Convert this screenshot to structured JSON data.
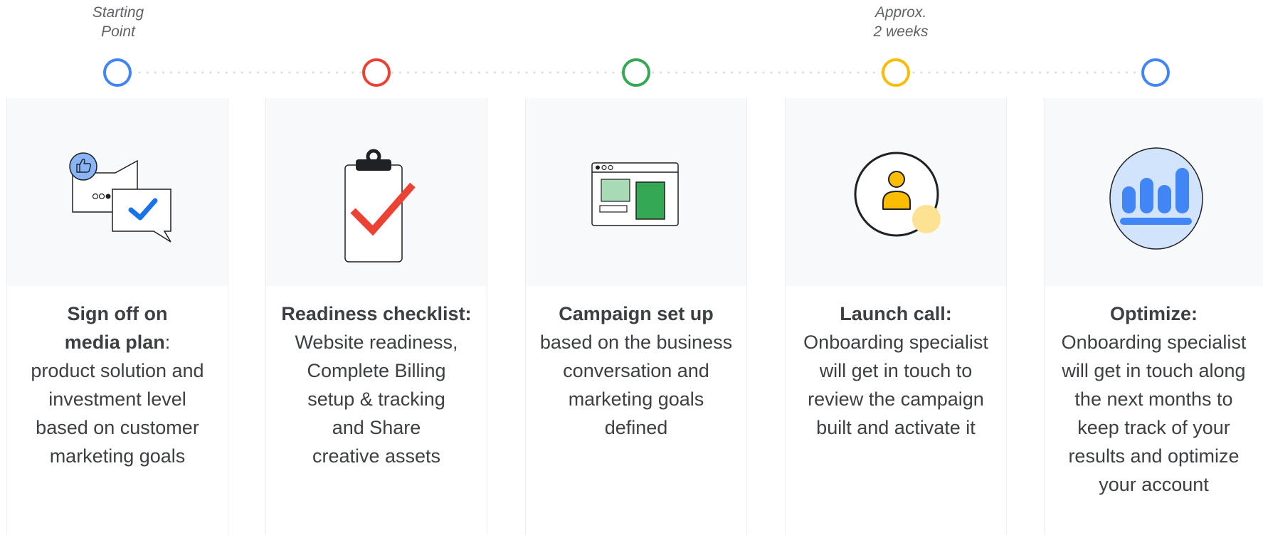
{
  "markers": {
    "start": [
      "Starting",
      "Point"
    ],
    "approx": [
      "Approx.",
      "2 weeks"
    ]
  },
  "colors": {
    "blue": "#4285f4",
    "red": "#ea4335",
    "green": "#34a853",
    "yellow": "#fbbc04",
    "dots": "#dadce0"
  },
  "steps": [
    {
      "id": "sign-off",
      "color": "blue",
      "icon": "chat-approval-icon",
      "title": [
        "Sign off on",
        "media plan"
      ],
      "title_suffix": ":",
      "lines": [
        "product solution and",
        "investment level",
        "based on customer",
        "marketing goals"
      ]
    },
    {
      "id": "readiness",
      "color": "red",
      "icon": "clipboard-check-icon",
      "title": [
        "Readiness checklist:"
      ],
      "title_suffix": "",
      "lines": [
        "Website readiness,",
        "Complete Billing",
        "setup & tracking",
        "and Share",
        "creative assets"
      ]
    },
    {
      "id": "campaign",
      "color": "green",
      "icon": "browser-window-icon",
      "title": [
        "Campaign set up"
      ],
      "title_suffix": "",
      "lines": [
        "based on the business",
        "conversation and",
        "marketing goals",
        "defined"
      ]
    },
    {
      "id": "launch",
      "color": "yellow",
      "icon": "person-circle-icon",
      "title": [
        "Launch call:"
      ],
      "title_suffix": "",
      "lines": [
        "Onboarding specialist",
        "will get in touch to",
        "review the campaign",
        "built and activate it"
      ]
    },
    {
      "id": "optimize",
      "color": "blue",
      "icon": "bar-chart-icon",
      "title": [
        "Optimize:"
      ],
      "title_suffix": "",
      "lines": [
        "Onboarding specialist",
        "will get in touch along",
        "the next months to",
        "keep track of your",
        "results and optimize",
        "your account"
      ]
    }
  ]
}
